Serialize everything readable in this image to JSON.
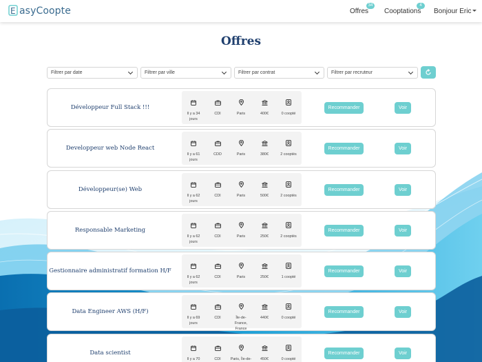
{
  "brand": {
    "logo_letter": "E",
    "logo_text": "asyCoopte",
    "colors": {
      "accent": "#6ecfd0",
      "title": "#1f3f6e",
      "logo": "#3a6b8f"
    }
  },
  "nav": {
    "offres_label": "Offres",
    "offres_badge": "34",
    "cooptations_label": "Cooptations",
    "cooptations_badge": "4",
    "user_label": "Bonjour Eric"
  },
  "page_title": "Offres",
  "filters": [
    {
      "placeholder": "Filtrer par date"
    },
    {
      "placeholder": "Filtrer par ville"
    },
    {
      "placeholder": "Filtrer par contrat"
    },
    {
      "placeholder": "Filtrer par recruteur"
    }
  ],
  "buttons": {
    "recommend": "Recommander",
    "view": "Voir"
  },
  "info_icons": [
    "calendar-icon",
    "briefcase-icon",
    "location-pin-icon",
    "bank-icon",
    "badge-icon"
  ],
  "offers": [
    {
      "title": "Développeur Full Stack !!!",
      "date": "Il y a 34 jours",
      "contract": "CDI",
      "city": "Paris",
      "salary": "400€",
      "coopted": "0 coopté"
    },
    {
      "title": "Developpeur web Node React",
      "date": "Il y a 61 jours",
      "contract": "CDD",
      "city": "Paris",
      "salary": "380€",
      "coopted": "2 cooptés"
    },
    {
      "title": "Développeur(se) Web",
      "date": "Il y a 62 jours",
      "contract": "CDI",
      "city": "Paris",
      "salary": "500€",
      "coopted": "2 cooptés"
    },
    {
      "title": "Responsable Marketing",
      "date": "Il y a 62 jours",
      "contract": "CDI",
      "city": "Paris",
      "salary": "250€",
      "coopted": "2 cooptés"
    },
    {
      "title": "Gestionnaire administratif formation H/F",
      "date": "Il y a 62 jours",
      "contract": "CDI",
      "city": "Paris",
      "salary": "250€",
      "coopted": "1 coopté"
    },
    {
      "title": "Data Engineer AWS (H/F)",
      "date": "Il y a 69 jours",
      "contract": "CDI",
      "city": "Île-de-France, France",
      "salary": "440€",
      "coopted": "0 coopté"
    },
    {
      "title": "Data scientist",
      "date": "Il y a 70",
      "contract": "CDI",
      "city": "Paris, Île-de-",
      "salary": "450€",
      "coopted": "0 coopté"
    }
  ]
}
